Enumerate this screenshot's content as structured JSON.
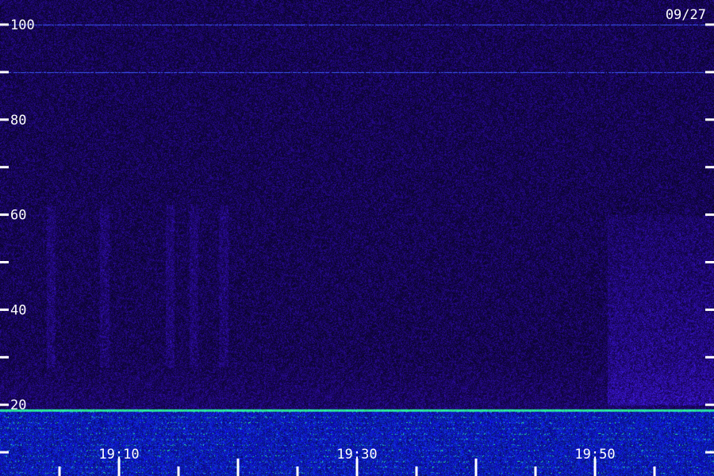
{
  "chart_data": {
    "type": "heatmap",
    "title": "",
    "date_label": "09/27",
    "xlabel": "",
    "ylabel": "",
    "x_tick_labels": [
      "19:10",
      "19:30",
      "19:50"
    ],
    "y_ticks": [
      {
        "value": 100,
        "label": "100"
      },
      {
        "value": 90,
        "label": ""
      },
      {
        "value": 80,
        "label": "80"
      },
      {
        "value": 70,
        "label": ""
      },
      {
        "value": 60,
        "label": "60"
      },
      {
        "value": 50,
        "label": ""
      },
      {
        "value": 40,
        "label": "40"
      },
      {
        "value": 30,
        "label": ""
      },
      {
        "value": 20,
        "label": "20"
      },
      {
        "value": 10,
        "label": ""
      }
    ],
    "ylim": [
      5,
      105
    ],
    "colors": {
      "background": "#1a0a5a",
      "noise_low": "#000010",
      "noise_mid": "#3a1aa0",
      "noise_high": "#4a4aff",
      "band_highlight": "#40ff90",
      "text": "#ffffff"
    },
    "features": {
      "horizontal_lines_at": [
        100,
        90
      ],
      "strong_band_at": 19,
      "low_band_range": [
        5,
        19
      ],
      "vertical_bursts": [
        {
          "x_minute": 4,
          "y_range": [
            28,
            62
          ]
        },
        {
          "x_minute": 8.5,
          "y_range": [
            28,
            62
          ]
        },
        {
          "x_minute": 14,
          "y_range": [
            28,
            62
          ]
        },
        {
          "x_minute": 16,
          "y_range": [
            28,
            62
          ]
        },
        {
          "x_minute": 18.5,
          "y_range": [
            28,
            62
          ]
        }
      ],
      "diffuse_region": {
        "x_minute_range": [
          51,
          60
        ],
        "y_range": [
          20,
          60
        ]
      }
    }
  }
}
